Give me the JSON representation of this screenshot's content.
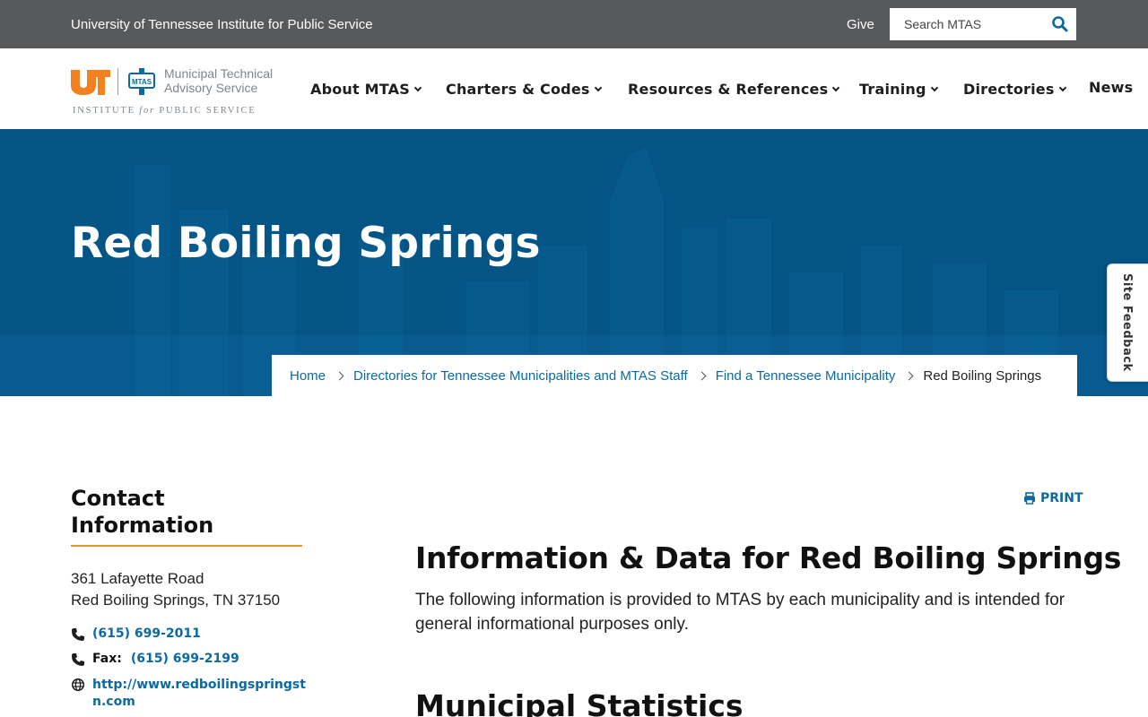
{
  "utility": {
    "title": "University of Tennessee Institute for Public Service",
    "give_label": "Give",
    "search_placeholder": "Search MTAS"
  },
  "logo": {
    "ut_mark": "UT",
    "badge_text": "MTAS",
    "name_line1": "Municipal Technical",
    "name_line2": "Advisory Service",
    "institute_pre": "INSTITUTE",
    "institute_for": "for",
    "institute_post": "PUBLIC SERVICE"
  },
  "nav": {
    "items": [
      {
        "label": "About MTAS",
        "has_dropdown": true
      },
      {
        "label": "Charters & Codes",
        "has_dropdown": true
      },
      {
        "label": "Resources & References",
        "has_dropdown": true
      },
      {
        "label": "Training",
        "has_dropdown": true
      },
      {
        "label": "Directories",
        "has_dropdown": true
      },
      {
        "label": "News",
        "has_dropdown": false
      }
    ]
  },
  "hero": {
    "title": "Red Boiling Springs"
  },
  "breadcrumb": {
    "items": [
      {
        "label": "Home"
      },
      {
        "label": "Directories for Tennessee Municipalities and MTAS Staff"
      },
      {
        "label": "Find a Tennessee Municipality"
      }
    ],
    "current": "Red Boiling Springs"
  },
  "feedback": {
    "label": "Site Feedback"
  },
  "contact": {
    "heading_line1": "Contact",
    "heading_line2": "Information",
    "address_line1": "361 Lafayette Road",
    "address_line2": "Red Boiling Springs, TN 37150",
    "phone": "(615) 699-2011",
    "fax_label": "Fax:",
    "fax": "(615) 699-2199",
    "website_line1": "http://www.redboilingspringst",
    "website_line2": "n.com"
  },
  "main": {
    "print_label": "PRINT",
    "heading": "Information & Data for Red Boiling Springs",
    "intro": "The following information is provided to MTAS by each municipality and is intended for general informational purposes only.",
    "section_heading": "Municipal Statistics"
  },
  "colors": {
    "utility_bar": "#58595b",
    "hero_blue": "#045485",
    "link_blue": "#0b6aa1",
    "accent_orange": "#e8952f",
    "ut_orange": "#f48120"
  }
}
